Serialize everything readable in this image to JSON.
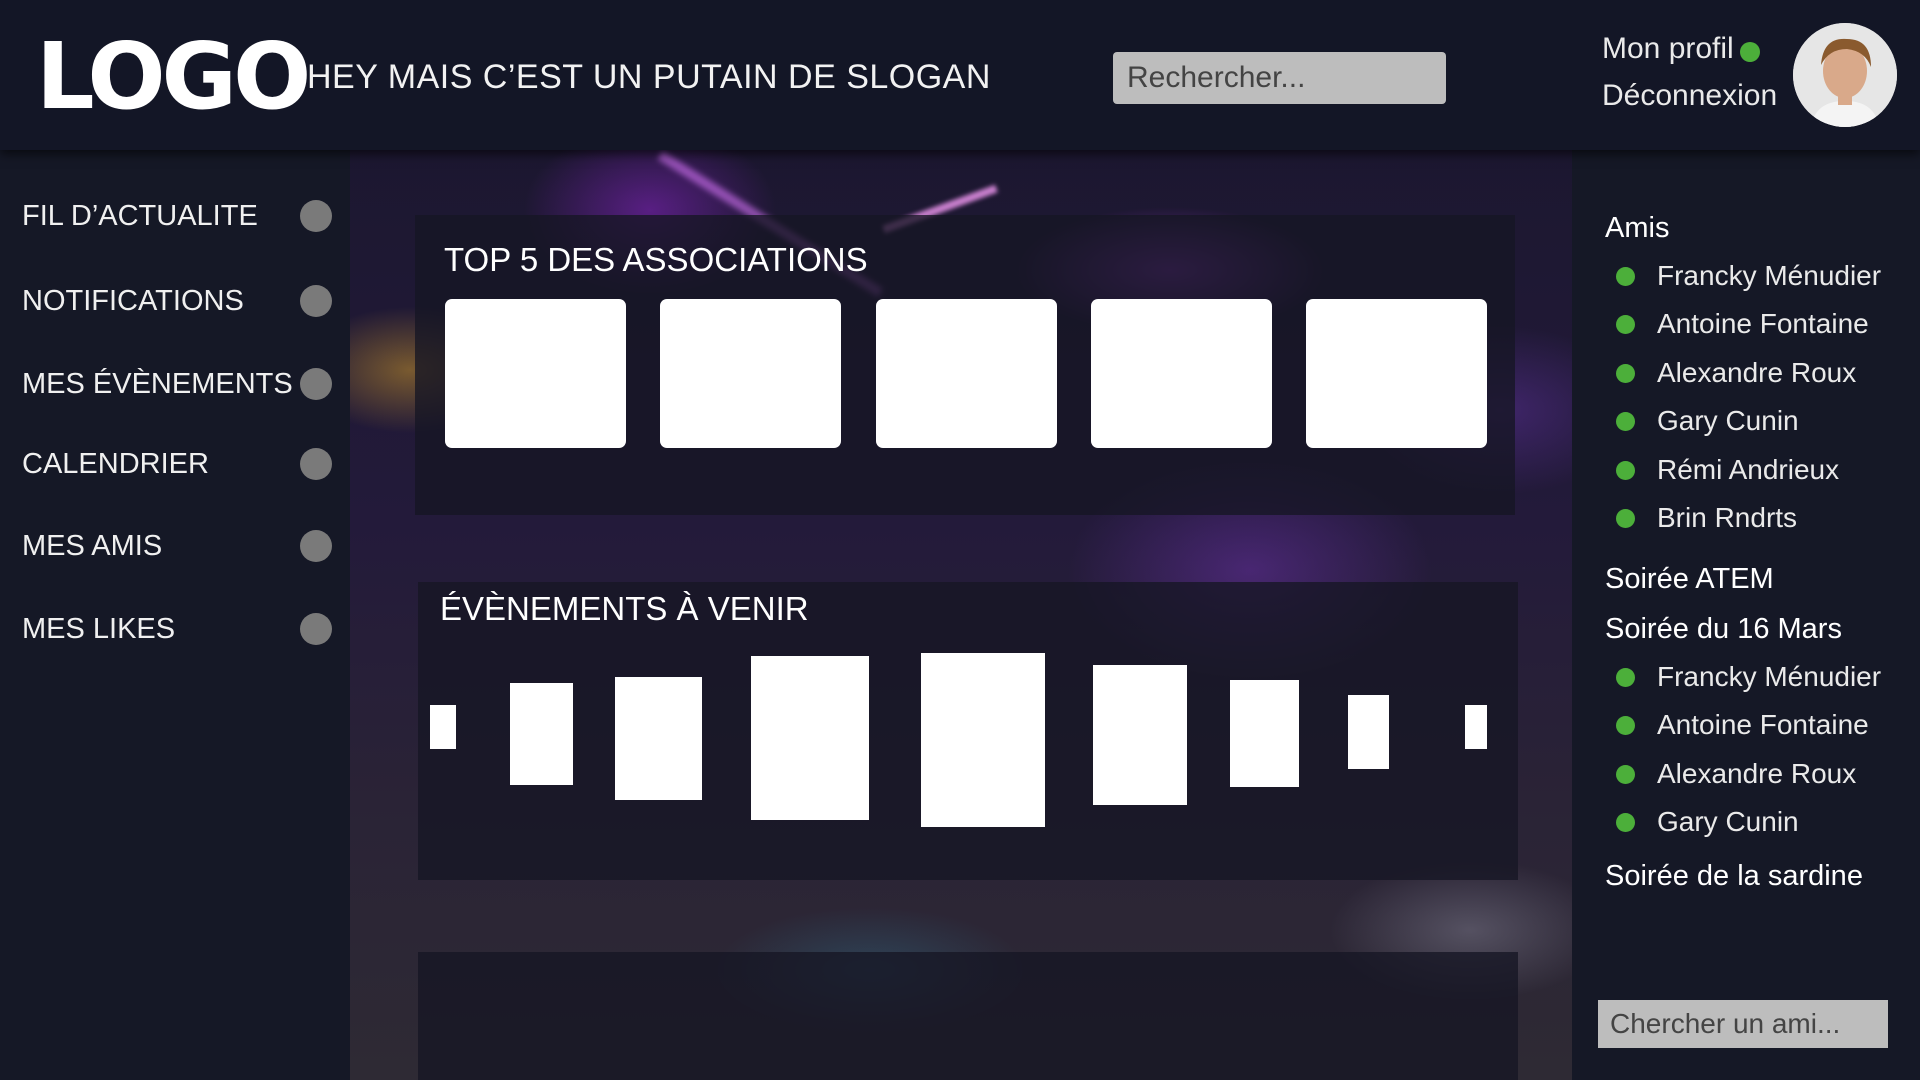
{
  "header": {
    "logo": "LOGO",
    "slogan": "HEY MAIS C’EST UN PUTAIN DE SLOGAN",
    "search_placeholder": "Rechercher...",
    "profile_label": "Mon profil",
    "logout_label": "Déconnexion",
    "online_color": "#4caf3a"
  },
  "sidebar": {
    "items": [
      {
        "label": "FIL D’ACTUALITE"
      },
      {
        "label": "NOTIFICATIONS"
      },
      {
        "label": "MES ÉVÈNEMENTS"
      },
      {
        "label": "CALENDRIER"
      },
      {
        "label": "MES AMIS"
      },
      {
        "label": "MES LIKES"
      }
    ]
  },
  "main": {
    "top_associations_title": "TOP 5 DES ASSOCIATIONS",
    "upcoming_events_title": "ÉVÈNEMENTS À VENIR"
  },
  "rightbar": {
    "friends_heading": "Amis",
    "friends": [
      {
        "name": "Francky Ménudier",
        "status_color": "#4caf3a"
      },
      {
        "name": "Antoine Fontaine",
        "status_color": "#4caf3a"
      },
      {
        "name": "Alexandre Roux",
        "status_color": "#4caf3a"
      },
      {
        "name": "Gary Cunin",
        "status_color": "#4caf3a"
      },
      {
        "name": "Rémi Andrieux",
        "status_color": "#4caf3a"
      },
      {
        "name": "Brin Rndrts",
        "status_color": "#4caf3a"
      }
    ],
    "group_atem": "Soirée ATEM",
    "group_16_mars": "Soirée du 16 Mars",
    "group_16_mars_members": [
      {
        "name": "Francky Ménudier",
        "status_color": "#4caf3a"
      },
      {
        "name": "Antoine Fontaine",
        "status_color": "#4caf3a"
      },
      {
        "name": "Alexandre Roux",
        "status_color": "#4caf3a"
      },
      {
        "name": "Gary Cunin",
        "status_color": "#4caf3a"
      }
    ],
    "group_sardine": "Soirée de la sardine",
    "friend_search_placeholder": "Chercher un ami..."
  }
}
